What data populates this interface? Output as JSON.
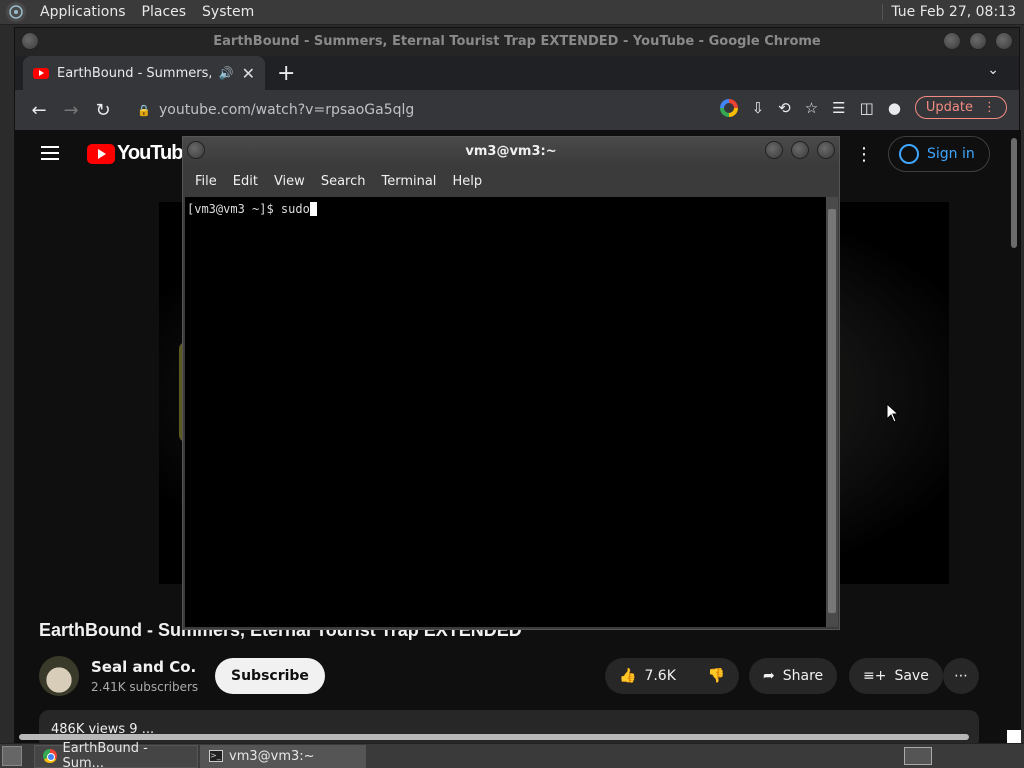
{
  "top_panel": {
    "menus": [
      "Applications",
      "Places",
      "System"
    ],
    "clock": "Tue Feb 27, 08:13"
  },
  "chrome": {
    "window_title": "EarthBound - Summers, Eternal Tourist Trap EXTENDED - YouTube - Google Chrome",
    "tab_title": "EarthBound - Summers, E",
    "url": "youtube.com/watch?v=rpsaoGa5qlg",
    "update_label": "Update"
  },
  "youtube": {
    "logo_text": "YouTube",
    "signin_label": "Sign in",
    "video_title": "EarthBound - Summers, Eternal Tourist Trap EXTENDED",
    "channel_name": "Seal and Co.",
    "subscribers": "2.41K subscribers",
    "subscribe_label": "Subscribe",
    "like_count": "7.6K",
    "share_label": "Share",
    "save_label": "Save",
    "description_preview": "486K views  9 ..."
  },
  "terminal": {
    "title": "vm3@vm3:~",
    "menus": [
      "File",
      "Edit",
      "View",
      "Search",
      "Terminal",
      "Help"
    ],
    "prompt": "[vm3@vm3 ~]$ ",
    "command": "sudo"
  },
  "taskbar": {
    "tasks": [
      "EarthBound - Sum...",
      "vm3@vm3:~"
    ]
  }
}
